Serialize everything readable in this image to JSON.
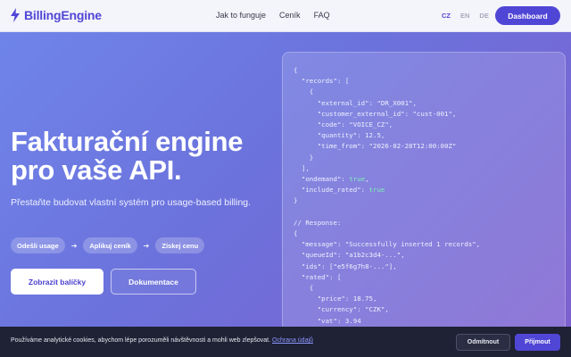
{
  "brand": {
    "name": "BillingEngine",
    "icon": "lightning-icon",
    "color": "#5046d6"
  },
  "nav": {
    "links": [
      "Jak to funguje",
      "Ceník",
      "FAQ"
    ],
    "languages": [
      "CZ",
      "EN",
      "DE"
    ],
    "active_language": "CZ",
    "dashboard_label": "Dashboard"
  },
  "hero": {
    "title_line1": "Fakturační engine",
    "title_line2": "pro vaše API.",
    "subtitle": "Přestaňte budovat vlastní systém pro usage-based billing.",
    "steps": [
      "Odešli usage",
      "Aplikuj ceník",
      "Získej cenu"
    ],
    "primary_button": "Zobrazit balíčky",
    "secondary_button": "Dokumentace"
  },
  "code_sample": {
    "lines": [
      "{",
      "  \"records\": [",
      "    {",
      "      \"external_id\": \"DR_X001\",",
      "      \"customer_external_id\": \"cust-001\",",
      "      \"code\": \"VOICE_CZ\",",
      "      \"quantity\": 12.5,",
      "      \"time_from\": \"2026-02-28T12:00:00Z\"",
      "    }",
      "  ],",
      "  \"ondemand\": true,",
      "  \"include_rated\": true",
      "}",
      "",
      "// Response:",
      "{",
      "  \"message\": \"Successfully inserted 1 records\",",
      "  \"queueId\": \"a1b2c3d4-...\",",
      "  \"ids\": [\"e5f6g7h8-...\"],",
      "  \"rated\": [",
      "    {",
      "      \"price\": 18.75,",
      "      \"currency\": \"CZK\",",
      "      \"vat\": 3.94"
    ]
  },
  "cookie": {
    "text": "Používáme analytické cookies, abychom lépe porozuměli návštěvnosti a mohli web zlepšovat.",
    "link": "Ochrana údajů",
    "reject_label": "Odmítnout",
    "accept_label": "Přijmout"
  }
}
